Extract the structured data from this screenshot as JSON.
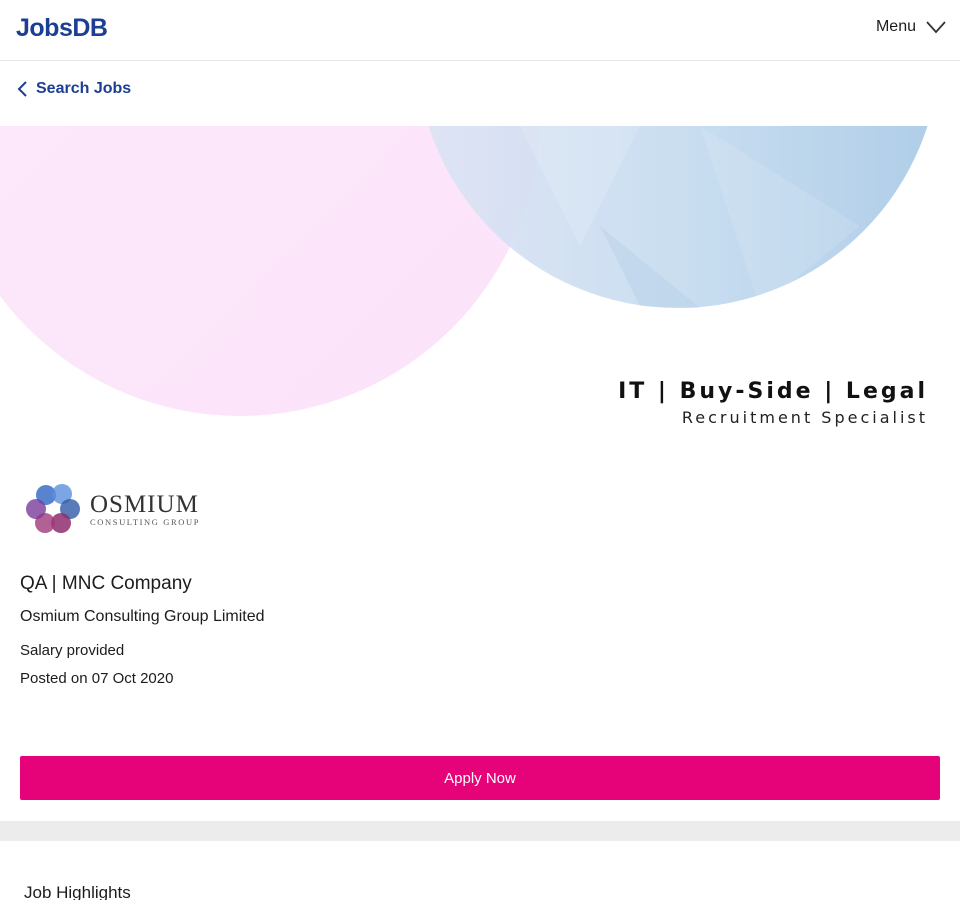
{
  "header": {
    "logo": "JobsDB",
    "menu_label": "Menu",
    "menu_icon": "chevron-down-icon"
  },
  "breadcrumb": {
    "back_icon": "chevron-left-icon",
    "label": "Search Jobs"
  },
  "banner": {
    "line1": "IT | Buy-Side | Legal",
    "line2": "Recruitment Specialist"
  },
  "company_logo": {
    "name": "OSMIUM",
    "tagline": "CONSULTING GROUP"
  },
  "job": {
    "title": "QA | MNC Company",
    "company": "Osmium Consulting Group Limited",
    "salary": "Salary provided",
    "posted_prefix": "Posted on",
    "posted_date": "07 Oct 2020"
  },
  "apply_button": "Apply Now",
  "section": {
    "heading": "Job Highlights"
  },
  "colors": {
    "brand": "#1c3f94",
    "apply": "#e60278",
    "banner_pink": "#fbe3fa",
    "banner_blue": "#a9cbe7"
  }
}
